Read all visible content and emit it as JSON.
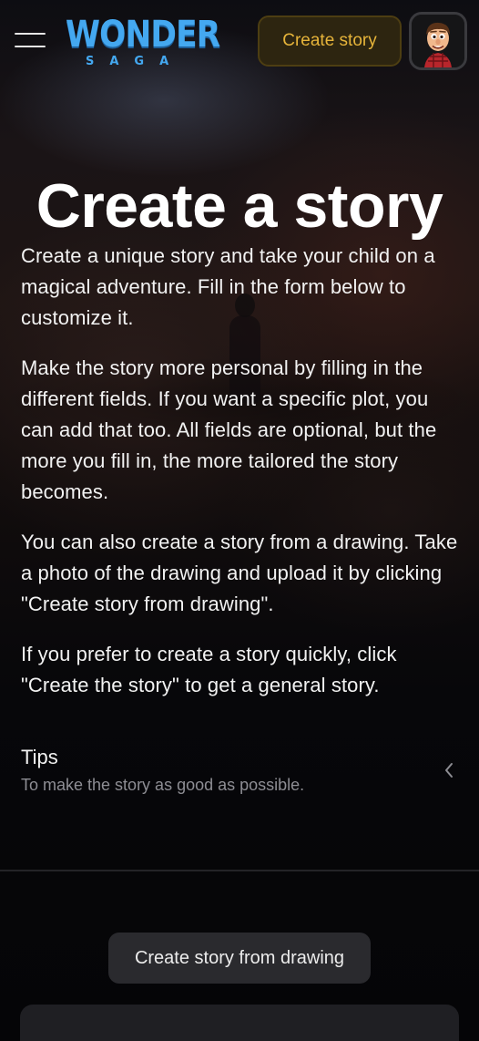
{
  "header": {
    "menu_icon": "hamburger-menu-icon",
    "logo": {
      "word": "WONDER",
      "sub": "SAGA"
    },
    "create_story_label": "Create story",
    "avatar_icon": "cartoon-avatar-icon",
    "accent_color": "#e6b43a",
    "brand_color": "#44a8f0"
  },
  "main": {
    "title": "Create a story",
    "paragraphs": [
      "Create a unique story and take your child on a magical adventure. Fill in the form below to customize it.",
      "Make the story more personal by filling in the different fields. If you want a specific plot, you can add that too. All fields are optional, but the more you fill in, the more tailored the story becomes.",
      "You can also create a story from a drawing. Take a photo of the drawing and upload it by clicking \"Create story from drawing\".",
      "If you prefer to create a story quickly, click \"Create the story\" to get a general story."
    ]
  },
  "tips": {
    "title": "Tips",
    "subtitle": "To make the story as good as possible.",
    "chevron_icon": "chevron-left-icon"
  },
  "actions": {
    "drawing_label": "Create story from drawing"
  }
}
